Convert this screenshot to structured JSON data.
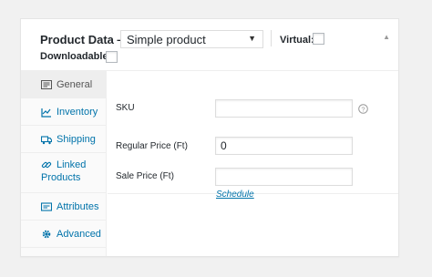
{
  "header": {
    "title": "Product Data —",
    "product_type": "Simple product",
    "virtual_label": "Virtual:",
    "downloadable_label": "Downloadable:"
  },
  "tabs": [
    {
      "label": "General",
      "icon": "general-icon",
      "active": true
    },
    {
      "label": "Inventory",
      "icon": "inventory-icon",
      "active": false
    },
    {
      "label": "Shipping",
      "icon": "shipping-icon",
      "active": false
    },
    {
      "label": "Linked Products",
      "icon": "linked-products-icon",
      "active": false
    },
    {
      "label": "Attributes",
      "icon": "attributes-icon",
      "active": false
    },
    {
      "label": "Advanced",
      "icon": "advanced-icon",
      "active": false
    }
  ],
  "fields": {
    "sku_label": "SKU",
    "sku_value": "",
    "regular_price_label": "Regular Price (Ft)",
    "regular_price_value": "0",
    "sale_price_label": "Sale Price (Ft)",
    "sale_price_value": "",
    "schedule_link": "Schedule"
  },
  "colors": {
    "link": "#0073aa",
    "active_tab_bg": "#eeeeee",
    "sidebar_bg": "#fafafa"
  }
}
